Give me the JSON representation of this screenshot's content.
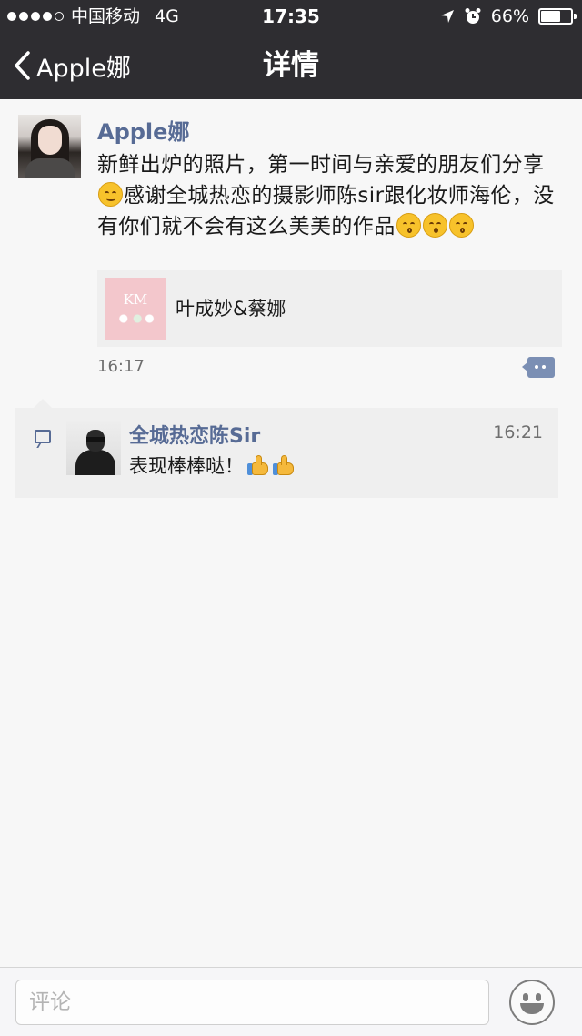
{
  "status_bar": {
    "carrier": "中国移动",
    "network": "4G",
    "time": "17:35",
    "battery": "66%",
    "battery_level": 0.66
  },
  "nav": {
    "back_label": "Apple娜",
    "title": "详情"
  },
  "post": {
    "author": "Apple娜",
    "text_part1": "新鲜出炉的照片，第一时间与亲爱的朋友们分享",
    "text_part2": "感谢全城热恋的摄影师陈sir跟化妆师海伦，没有你们就不会有这么美美的作品",
    "link_title": "叶成妙&蔡娜",
    "thumb_text": "KM",
    "time": "16:17"
  },
  "comments": [
    {
      "author": "全城热恋陈Sir",
      "time": "16:21",
      "text": "表现棒棒哒！"
    }
  ],
  "bottom": {
    "input_placeholder": "评论"
  },
  "colors": {
    "navbar": "#2e2d31",
    "link_name": "#576b95",
    "background": "#f7f7f7"
  },
  "icons": {
    "back": "chevron-left-icon",
    "comment_action": "comment-bubble-icon",
    "comment_list": "comment-icon",
    "emoji_button": "smiley-face-icon"
  }
}
